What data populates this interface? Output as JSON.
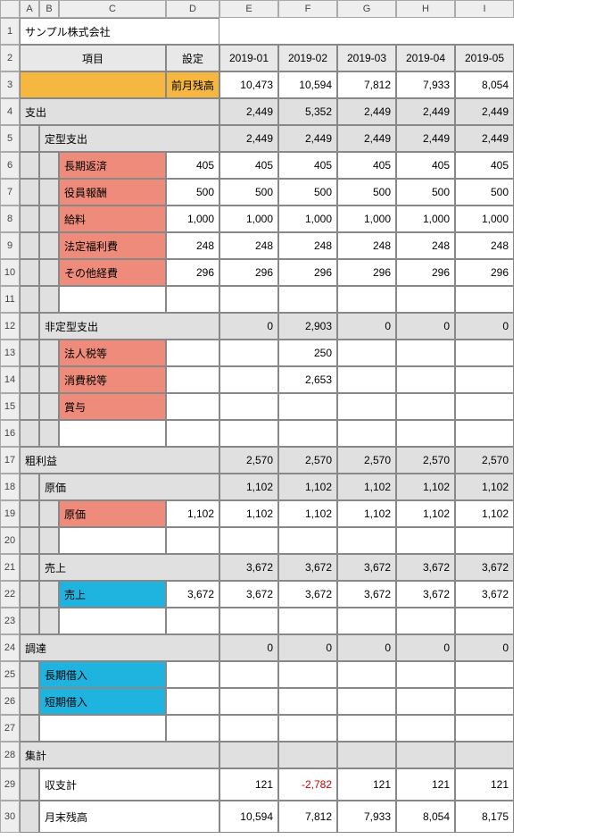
{
  "colHeaders": [
    "A",
    "B",
    "C",
    "D",
    "E",
    "F",
    "G",
    "H",
    "I"
  ],
  "rowHeaders": [
    "1",
    "2",
    "3",
    "4",
    "5",
    "6",
    "7",
    "8",
    "9",
    "10",
    "11",
    "12",
    "13",
    "14",
    "15",
    "16",
    "17",
    "18",
    "19",
    "20",
    "21",
    "22",
    "23",
    "24",
    "25",
    "26",
    "27",
    "28",
    "29",
    "30"
  ],
  "company": "サンプル株式会社",
  "header": {
    "item": "項目",
    "setting": "設定"
  },
  "months": [
    "2019-01",
    "2019-02",
    "2019-03",
    "2019-04",
    "2019-05"
  ],
  "prevBalance": {
    "label": "前月残高",
    "vals": [
      "10,473",
      "10,594",
      "7,812",
      "7,933",
      "8,054"
    ]
  },
  "spending": {
    "label": "支出",
    "vals": [
      "2,449",
      "5,352",
      "2,449",
      "2,449",
      "2,449"
    ]
  },
  "fixedSpend": {
    "label": "定型支出",
    "vals": [
      "2,449",
      "2,449",
      "2,449",
      "2,449",
      "2,449"
    ]
  },
  "longRepay": {
    "label": "長期返済",
    "set": "405",
    "vals": [
      "405",
      "405",
      "405",
      "405",
      "405"
    ]
  },
  "execComp": {
    "label": "役員報酬",
    "set": "500",
    "vals": [
      "500",
      "500",
      "500",
      "500",
      "500"
    ]
  },
  "salary": {
    "label": "給料",
    "set": "1,000",
    "vals": [
      "1,000",
      "1,000",
      "1,000",
      "1,000",
      "1,000"
    ]
  },
  "welfare": {
    "label": "法定福利費",
    "set": "248",
    "vals": [
      "248",
      "248",
      "248",
      "248",
      "248"
    ]
  },
  "otherExp": {
    "label": "その他経費",
    "set": "296",
    "vals": [
      "296",
      "296",
      "296",
      "296",
      "296"
    ]
  },
  "irregSpend": {
    "label": "非定型支出",
    "vals": [
      "0",
      "2,903",
      "0",
      "0",
      "0"
    ]
  },
  "corpTax": {
    "label": "法人税等",
    "vals": [
      "",
      "250",
      "",
      "",
      ""
    ]
  },
  "consTax": {
    "label": "消費税等",
    "vals": [
      "",
      "2,653",
      "",
      "",
      ""
    ]
  },
  "bonus": {
    "label": "賞与"
  },
  "grossProfit": {
    "label": "粗利益",
    "vals": [
      "2,570",
      "2,570",
      "2,570",
      "2,570",
      "2,570"
    ]
  },
  "costGroup": {
    "label": "原価",
    "vals": [
      "1,102",
      "1,102",
      "1,102",
      "1,102",
      "1,102"
    ]
  },
  "cost": {
    "label": "原価",
    "set": "1,102",
    "vals": [
      "1,102",
      "1,102",
      "1,102",
      "1,102",
      "1,102"
    ]
  },
  "salesGroup": {
    "label": "売上",
    "vals": [
      "3,672",
      "3,672",
      "3,672",
      "3,672",
      "3,672"
    ]
  },
  "sales": {
    "label": "売上",
    "set": "3,672",
    "vals": [
      "3,672",
      "3,672",
      "3,672",
      "3,672",
      "3,672"
    ]
  },
  "finance": {
    "label": "調達",
    "vals": [
      "0",
      "0",
      "0",
      "0",
      "0"
    ]
  },
  "longBorrow": {
    "label": "長期借入"
  },
  "shortBorrow": {
    "label": "短期借入"
  },
  "summary": {
    "label": "集計"
  },
  "balance": {
    "label": "収支計",
    "vals": [
      "121",
      "-2,782",
      "121",
      "121",
      "121"
    ]
  },
  "endBalance": {
    "label": "月末残高",
    "vals": [
      "10,594",
      "7,812",
      "7,933",
      "8,054",
      "8,175"
    ]
  }
}
